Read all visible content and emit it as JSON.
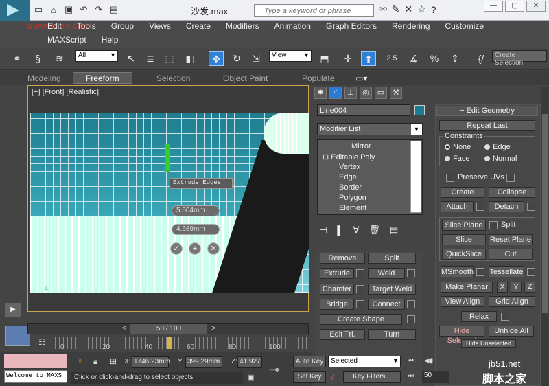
{
  "title_bar": {
    "file_title": "沙发.max",
    "search_placeholder": "Type a keyword or phrase"
  },
  "watermark": "WWW.3DXY.COM",
  "menu": {
    "row1": [
      "Edit",
      "Tools",
      "Group",
      "Views",
      "Create",
      "Modifiers",
      "Animation",
      "Graph Editors",
      "Rendering",
      "Customize"
    ],
    "row2": [
      "MAXScript",
      "Help"
    ]
  },
  "toolbar": {
    "selection_filter": "All",
    "reference_coord": "View",
    "snap_angle_label": "2.5",
    "create_selection": "Create Selection"
  },
  "ribbon_tabs": [
    "Modeling",
    "Freeform",
    "Selection",
    "Object Paint",
    "Populate"
  ],
  "ribbon_active": "Freeform",
  "viewport": {
    "label": "[+] [Front] [Realistic]",
    "caddy_title": "Extrude Edges",
    "caddy_height": "5.504mm",
    "caddy_width": "4.689mm"
  },
  "timeline": {
    "slider_label": "50 / 100",
    "ruler_labels": [
      "0",
      "20",
      "40",
      "60",
      "80",
      "100"
    ]
  },
  "command_panel": {
    "object_name": "Line004",
    "modifier_list": "Modifier List",
    "stack": {
      "mirror": "Mirror",
      "editable_poly": "Editable Poly",
      "vertex": "Vertex",
      "edge": "Edge",
      "border": "Border",
      "polygon": "Polygon",
      "element": "Element"
    },
    "edit_edges": {
      "remove": "Remove",
      "split": "Split",
      "extrude": "Extrude",
      "weld": "Weld",
      "chamfer": "Chamfer",
      "target_weld": "Target Weld",
      "bridge": "Bridge",
      "connect": "Connect",
      "create_shape": "Create Shape",
      "edit_tri": "Edit Tri.",
      "turn": "Turn"
    },
    "edit_geometry": {
      "header": "Edit Geometry",
      "repeat_last": "Repeat Last",
      "constraints_label": "Constraints",
      "none": "None",
      "edge": "Edge",
      "face": "Face",
      "normal": "Normal",
      "preserve_uvs": "Preserve UVs",
      "create": "Create",
      "collapse": "Collapse",
      "attach": "Attach",
      "detach": "Detach",
      "slice_plane": "Slice Plane",
      "split": "Split",
      "slice": "Slice",
      "reset_plane": "Reset Plane",
      "quickslice": "QuickSlice",
      "cut": "Cut",
      "msmooth": "MSmooth",
      "tessellate": "Tessellate",
      "make_planar": "Make Planar",
      "x": "X",
      "y": "Y",
      "z": "Z",
      "view_align": "View Align",
      "grid_align": "Grid Align",
      "relax": "Relax",
      "hide_selected": "Hide Selected",
      "unhide_all": "Unhide All",
      "hide_unselected": "Hide Unselected"
    }
  },
  "status": {
    "welcome": "Welcome to MAXS",
    "prompt": "Click or click-and-drag to select objects",
    "x_label": "X:",
    "x": "1746.23mm",
    "y_label": "Y:",
    "y": "399.29mm",
    "z_label": "Z:",
    "z": "41.927",
    "auto_key": "Auto Key",
    "set_key": "Set Key",
    "selected": "Selected",
    "key_filters": "Key Filters...",
    "frame": "50"
  },
  "site_watermark": {
    "domain": "jb51.net",
    "name": "脚本之家"
  },
  "colors": {
    "accent": "#2b7ad4",
    "viewport_border": "#c9a64a",
    "object_color": "#1e7a92"
  }
}
